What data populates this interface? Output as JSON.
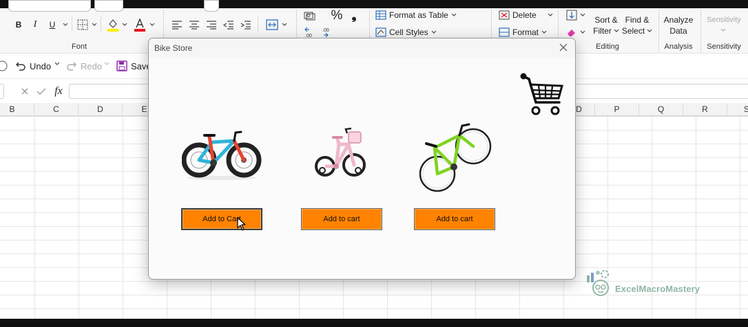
{
  "ribbon": {
    "font_label": "Font",
    "editing_label": "Editing",
    "analysis_label": "Analysis",
    "sensitivity_label": "Sensitivity",
    "format_as_table": "Format as Table",
    "cell_styles": "Cell Styles",
    "delete": "Delete",
    "format": "Format",
    "sort_filter_1": "Sort &",
    "sort_filter_2": "Filter",
    "find_select_1": "Find &",
    "find_select_2": "Select",
    "analyze_1": "Analyze",
    "analyze_2": "Data",
    "sensitivity": "Sensitivity",
    "bold": "B",
    "italic": "I",
    "underline": "U",
    "percent": "%",
    "comma": "❟"
  },
  "quick_access": {
    "undo": "Undo",
    "redo": "Redo",
    "save": "Save"
  },
  "formula_bar": {
    "fx": "fx"
  },
  "columns": [
    "B",
    "C",
    "D",
    "E",
    "",
    "",
    "",
    "",
    "",
    "",
    "",
    "",
    "",
    "D",
    "P",
    "Q",
    "R",
    "S"
  ],
  "dialog": {
    "title": "Bike Store",
    "buttons": [
      "Add to Cart",
      "Add to cart",
      "Add to cart"
    ]
  },
  "watermark": {
    "text": "ExcelMacroMastery"
  },
  "colors": {
    "accent_orange": "#ff8200",
    "bike1_frame": "#e8432f",
    "bike1_accent": "#2fb4d8",
    "bike2_frame": "#f0b8cc",
    "bike3_frame": "#7ed321"
  }
}
